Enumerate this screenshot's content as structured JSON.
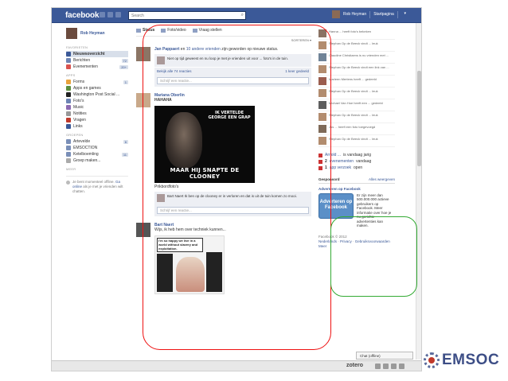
{
  "topbar": {
    "logo": "facebook",
    "search_placeholder": "Search",
    "user_name": "Rob Heyman",
    "home_label": "Startpagina"
  },
  "sidebar": {
    "user_name": "Rob Heyman",
    "favorites_header": "FAVORIETEN",
    "favorites": [
      {
        "label": "Nieuwsoverzicht",
        "count": "",
        "selected": true
      },
      {
        "label": "Berichten",
        "count": "72"
      },
      {
        "label": "Evenementen",
        "count": "20+"
      }
    ],
    "apps_header": "APPS",
    "apps": [
      {
        "label": "Forms",
        "count": "1"
      },
      {
        "label": "Apps en games",
        "count": ""
      },
      {
        "label": "Washington Post Social ...",
        "count": ""
      },
      {
        "label": "Foto's",
        "count": ""
      },
      {
        "label": "Music",
        "count": ""
      },
      {
        "label": "Notities",
        "count": ""
      },
      {
        "label": "Vragen",
        "count": ""
      },
      {
        "label": "Links",
        "count": ""
      }
    ],
    "groups_header": "GROEPEN",
    "groups": [
      {
        "label": "Artevelde",
        "count": "6"
      },
      {
        "label": "EMSOCTION",
        "count": ""
      },
      {
        "label": "Ketelboemling",
        "count": "11"
      },
      {
        "label": "Groep maken...",
        "count": ""
      }
    ],
    "more_label": "MEER",
    "chat_note": "Je bent momenteel offline.",
    "chat_link": "Ga online",
    "chat_note2": "als je met je vrienden wilt chatten."
  },
  "composer": {
    "status": "Status",
    "photo": "Foto/video",
    "question": "Vraag stellen",
    "sort": "SORTEREN"
  },
  "feed": {
    "story1_title_pre": "Jan Pappaert",
    "story1_title_mid": "en",
    "story1_title_link": "10 andere vrienden",
    "story1_title_post": "zijn geworden op nieuwe status.",
    "story1_comment": "Niet op tijd geweest en nu loop je met je vrienden uit voor ... foto's in de tuin.",
    "story1_likes": "Bekijk alle 74 reacties",
    "story1_shares": "1 keer gedeeld",
    "comment_placeholder": "Schrijf een reactie...",
    "story2_name": "Mariana Oberlin",
    "story2_text": "HAHAHA",
    "meme_top": "IK VERTELDE GEORGE EEN GRAP",
    "meme_bottom": "MAAR HIJ SNAPTE DE CLOONEY",
    "story2_album": "Prikbordfoto's",
    "story2_comment": "Bart Naert Ik ben op de clooney er in verloren en dat is uit de tuin komen zo mooi.",
    "story3_name": "Bart Naert",
    "story3_text": "Wijs, ik heb hem over techniek kunnen...",
    "comic_caption": "I'm so happy we live in a world without slavery and exploitation."
  },
  "right": {
    "tickers": [
      "Hanna ... heeft foto's bekeken",
      "Stephan Op de Beeck vindt ... leuk",
      "Claudine Christiaens is nu vrienden met ...",
      "Stephan Op de Beeck vindt een link van ...",
      "Marleen Mertens heeft ... gedeeld",
      "Stephan Op de Beeck vindt ... leuk",
      "Michael Van Hoe heeft een ... gedeeld",
      "Stephan Op de Beeck vindt ... leuk",
      "Jos ... heeft een foto toegevoegd",
      "Stephan Op de Beeck vindt ... leuk"
    ],
    "birthday": "is vandaag jarig",
    "birthday_name": "Arnold ...",
    "events1_count": "2",
    "events1_link": "evenementen",
    "events1_post": "vandaag",
    "events2_count": "1",
    "events2_link": "app verzoek",
    "events2_post": "open",
    "ads_header": "Gesponsord",
    "ads_link": "Alles weergeven",
    "ad_title": "Adverteren op Facebook",
    "ad_image_text": "Adverteren op Facebook",
    "ad_text": "Er zijn meer dan 500.000.000 actieve gebruikers op Facebook. Meer informatie over hoe je nu gerichte advertenties kan maken.",
    "footer_copy": "Facebook © 2012",
    "footer_lang": "Nederlands",
    "footer_privacy": "Privacy",
    "footer_terms": "Gebruiksvoorwaarden",
    "footer_more": "Meer"
  },
  "chat": {
    "label": "Chat (offline)"
  },
  "statusbar": {
    "zotero": "zotero"
  },
  "brand": {
    "name": "EMSOC"
  },
  "colors": {
    "facebook_blue": "#3b5998",
    "highlight_red": "#e11111",
    "highlight_green": "#33aa33",
    "emsoc_blue": "#3d4e86"
  }
}
